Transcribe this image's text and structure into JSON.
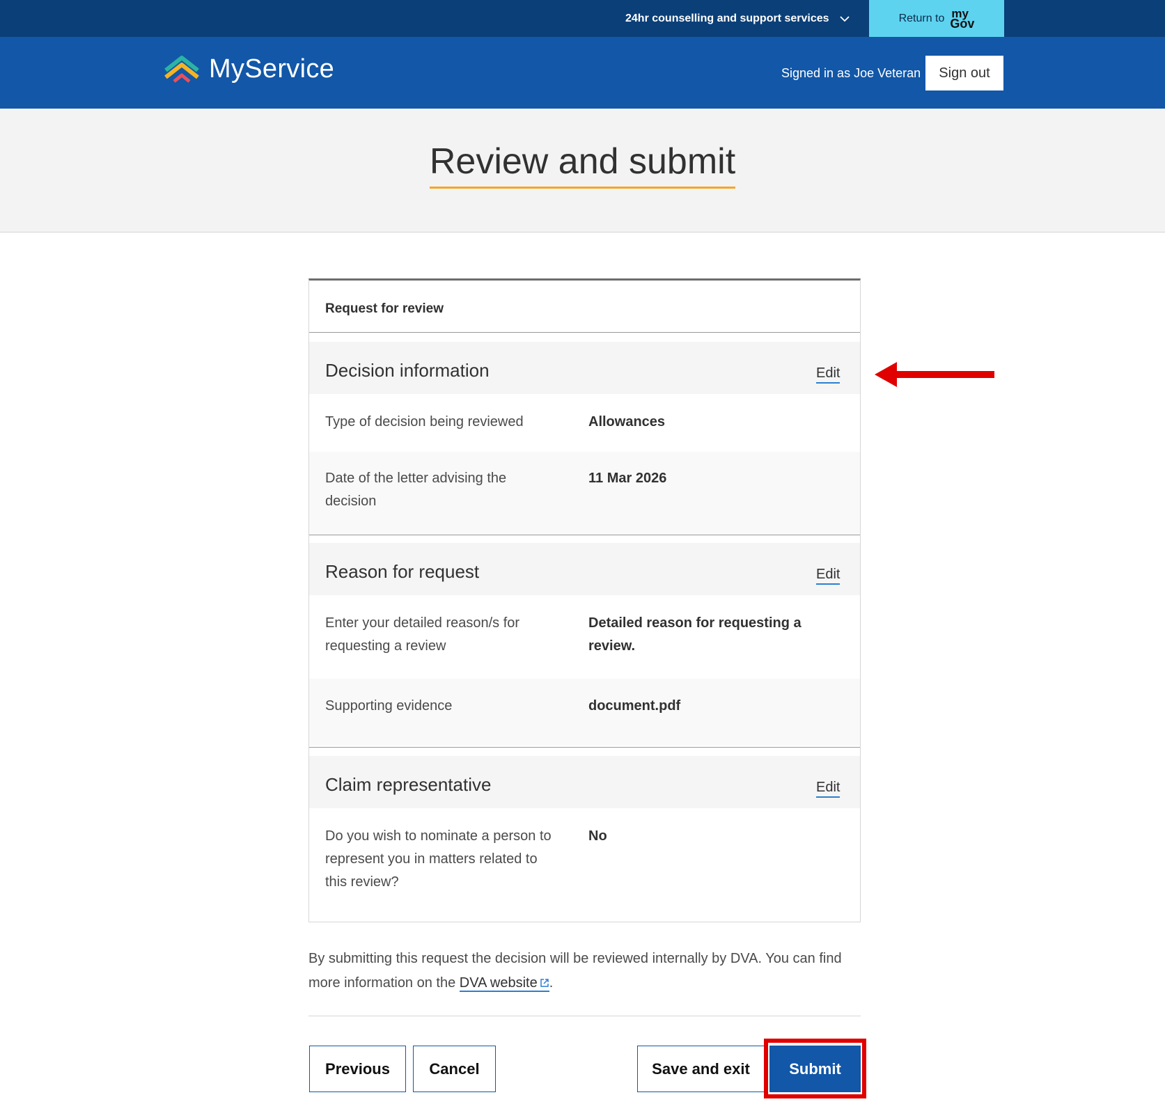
{
  "topbar": {
    "support_label": "24hr counselling and support services",
    "return_label": "Return to",
    "mygov_my": "my",
    "mygov_gov": "Gov"
  },
  "header": {
    "brand": "MyService",
    "signed_in": "Signed in as Joe Veteran",
    "sign_out": "Sign out"
  },
  "page": {
    "title": "Review and submit"
  },
  "card": {
    "header": "Request for review",
    "sections": [
      {
        "title": "Decision information",
        "edit": "Edit",
        "rows": [
          {
            "label": "Type of decision being reviewed",
            "value": "Allowances"
          },
          {
            "label": "Date of the letter advising the decision",
            "value": "11 Mar 2026"
          }
        ]
      },
      {
        "title": "Reason for request",
        "edit": "Edit",
        "rows": [
          {
            "label": "Enter your detailed reason/s for requesting a review",
            "value": "Detailed reason for requesting a review."
          },
          {
            "label": "Supporting evidence",
            "value": "document.pdf"
          }
        ]
      },
      {
        "title": "Claim representative",
        "edit": "Edit",
        "rows": [
          {
            "label": "Do you wish to nominate a person to represent you in matters related to this review?",
            "value": "No"
          }
        ]
      }
    ]
  },
  "note": {
    "text": "By submitting this request the decision will be reviewed internally by DVA. You can find more information on the",
    "link": "DVA website",
    "end": "."
  },
  "buttons": {
    "previous": "Previous",
    "cancel": "Cancel",
    "save_exit": "Save and exit",
    "submit": "Submit"
  },
  "colors": {
    "topbar": "#0b3f78",
    "header": "#1257a8",
    "mygov": "#5ed3f0",
    "title_underline": "#f5a623",
    "annotation": "#e00000"
  }
}
